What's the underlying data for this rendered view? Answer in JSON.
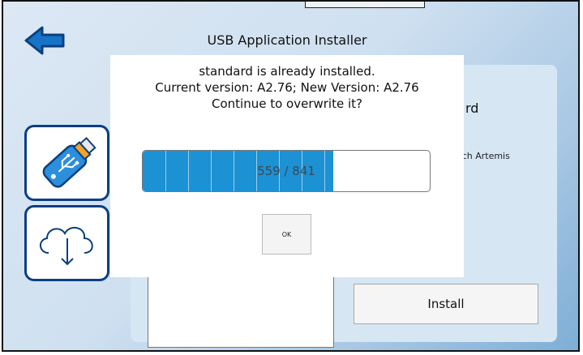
{
  "header": {
    "title": "USB Application Installer",
    "back_icon": "arrow-left-icon"
  },
  "background_panel": {
    "title_fragment": "rd",
    "subtitle_fragment": "ouch Artemis",
    "install_label": "Install"
  },
  "sidebar": {
    "items": [
      {
        "icon": "usb-drive-icon"
      },
      {
        "icon": "cloud-download-icon"
      }
    ]
  },
  "dialog": {
    "message_line1": "standard is already installed.",
    "message_line2": "Current version: A2.76; New Version: A2.76",
    "message_line3": "Continue to overwrite it?",
    "progress_current": 559,
    "progress_total": 841,
    "progress_text": "559 / 841",
    "ok_label": "OK"
  },
  "colors": {
    "accent": "#1c91d4",
    "icon_border": "#0d3f82"
  }
}
